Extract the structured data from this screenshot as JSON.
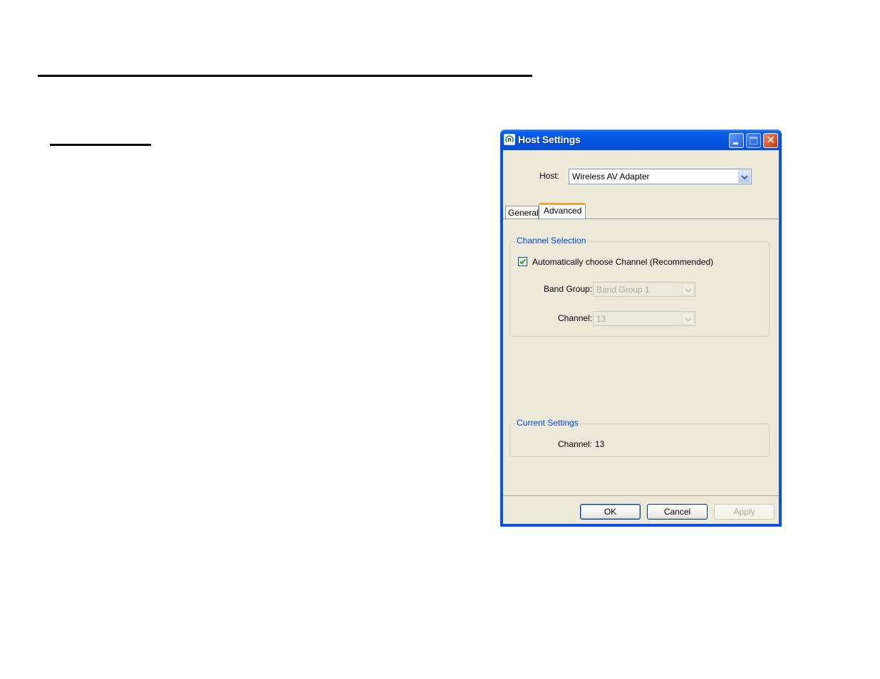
{
  "document": {
    "decorations": [
      "horizontal-rule-long",
      "horizontal-rule-short"
    ]
  },
  "window": {
    "title": "Host Settings",
    "icon": "app-logo-icon",
    "controls": {
      "minimize": "minimize-icon",
      "maximize": "maximize-icon",
      "close": "close-icon"
    },
    "accent_color": "#0a53e0",
    "host": {
      "label": "Host:",
      "selected": "Wireless AV Adapter"
    },
    "tabs": [
      {
        "label": "General",
        "active": false
      },
      {
        "label": "Advanced",
        "active": true
      }
    ],
    "channel_selection": {
      "legend": "Channel Selection",
      "auto_checkbox": {
        "label": "Automatically choose Channel (Recommended)",
        "checked": true
      },
      "band_group": {
        "label": "Band Group:",
        "selected": "Band Group 1",
        "disabled": true
      },
      "channel": {
        "label": "Channel:",
        "selected": "13",
        "disabled": true
      }
    },
    "current_settings": {
      "legend": "Current Settings",
      "channel_label": "Channel:",
      "channel_value": "13"
    },
    "buttons": {
      "ok": "OK",
      "cancel": "Cancel",
      "apply": "Apply"
    }
  }
}
